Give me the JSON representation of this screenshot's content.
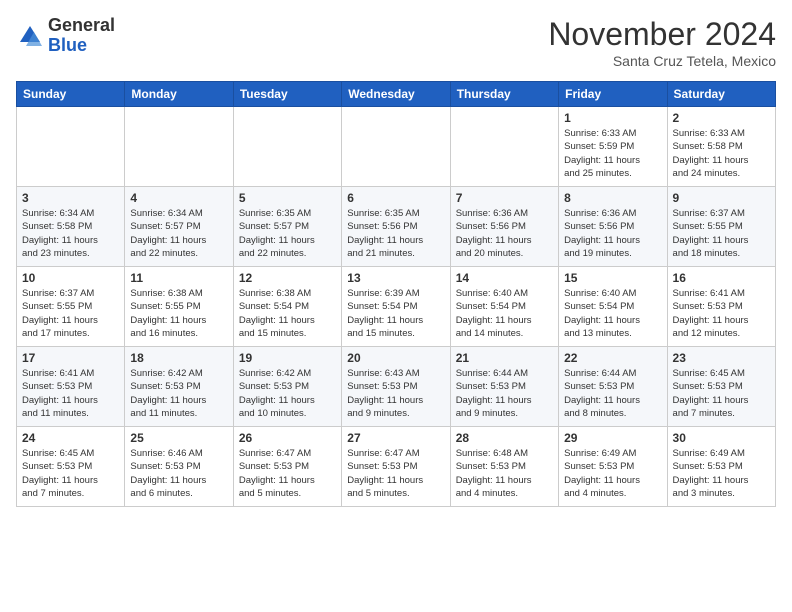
{
  "header": {
    "logo_line1": "General",
    "logo_line2": "Blue",
    "month": "November 2024",
    "location": "Santa Cruz Tetela, Mexico"
  },
  "weekdays": [
    "Sunday",
    "Monday",
    "Tuesday",
    "Wednesday",
    "Thursday",
    "Friday",
    "Saturday"
  ],
  "weeks": [
    [
      {
        "day": "",
        "info": ""
      },
      {
        "day": "",
        "info": ""
      },
      {
        "day": "",
        "info": ""
      },
      {
        "day": "",
        "info": ""
      },
      {
        "day": "",
        "info": ""
      },
      {
        "day": "1",
        "info": "Sunrise: 6:33 AM\nSunset: 5:59 PM\nDaylight: 11 hours\nand 25 minutes."
      },
      {
        "day": "2",
        "info": "Sunrise: 6:33 AM\nSunset: 5:58 PM\nDaylight: 11 hours\nand 24 minutes."
      }
    ],
    [
      {
        "day": "3",
        "info": "Sunrise: 6:34 AM\nSunset: 5:58 PM\nDaylight: 11 hours\nand 23 minutes."
      },
      {
        "day": "4",
        "info": "Sunrise: 6:34 AM\nSunset: 5:57 PM\nDaylight: 11 hours\nand 22 minutes."
      },
      {
        "day": "5",
        "info": "Sunrise: 6:35 AM\nSunset: 5:57 PM\nDaylight: 11 hours\nand 22 minutes."
      },
      {
        "day": "6",
        "info": "Sunrise: 6:35 AM\nSunset: 5:56 PM\nDaylight: 11 hours\nand 21 minutes."
      },
      {
        "day": "7",
        "info": "Sunrise: 6:36 AM\nSunset: 5:56 PM\nDaylight: 11 hours\nand 20 minutes."
      },
      {
        "day": "8",
        "info": "Sunrise: 6:36 AM\nSunset: 5:56 PM\nDaylight: 11 hours\nand 19 minutes."
      },
      {
        "day": "9",
        "info": "Sunrise: 6:37 AM\nSunset: 5:55 PM\nDaylight: 11 hours\nand 18 minutes."
      }
    ],
    [
      {
        "day": "10",
        "info": "Sunrise: 6:37 AM\nSunset: 5:55 PM\nDaylight: 11 hours\nand 17 minutes."
      },
      {
        "day": "11",
        "info": "Sunrise: 6:38 AM\nSunset: 5:55 PM\nDaylight: 11 hours\nand 16 minutes."
      },
      {
        "day": "12",
        "info": "Sunrise: 6:38 AM\nSunset: 5:54 PM\nDaylight: 11 hours\nand 15 minutes."
      },
      {
        "day": "13",
        "info": "Sunrise: 6:39 AM\nSunset: 5:54 PM\nDaylight: 11 hours\nand 15 minutes."
      },
      {
        "day": "14",
        "info": "Sunrise: 6:40 AM\nSunset: 5:54 PM\nDaylight: 11 hours\nand 14 minutes."
      },
      {
        "day": "15",
        "info": "Sunrise: 6:40 AM\nSunset: 5:54 PM\nDaylight: 11 hours\nand 13 minutes."
      },
      {
        "day": "16",
        "info": "Sunrise: 6:41 AM\nSunset: 5:53 PM\nDaylight: 11 hours\nand 12 minutes."
      }
    ],
    [
      {
        "day": "17",
        "info": "Sunrise: 6:41 AM\nSunset: 5:53 PM\nDaylight: 11 hours\nand 11 minutes."
      },
      {
        "day": "18",
        "info": "Sunrise: 6:42 AM\nSunset: 5:53 PM\nDaylight: 11 hours\nand 11 minutes."
      },
      {
        "day": "19",
        "info": "Sunrise: 6:42 AM\nSunset: 5:53 PM\nDaylight: 11 hours\nand 10 minutes."
      },
      {
        "day": "20",
        "info": "Sunrise: 6:43 AM\nSunset: 5:53 PM\nDaylight: 11 hours\nand 9 minutes."
      },
      {
        "day": "21",
        "info": "Sunrise: 6:44 AM\nSunset: 5:53 PM\nDaylight: 11 hours\nand 9 minutes."
      },
      {
        "day": "22",
        "info": "Sunrise: 6:44 AM\nSunset: 5:53 PM\nDaylight: 11 hours\nand 8 minutes."
      },
      {
        "day": "23",
        "info": "Sunrise: 6:45 AM\nSunset: 5:53 PM\nDaylight: 11 hours\nand 7 minutes."
      }
    ],
    [
      {
        "day": "24",
        "info": "Sunrise: 6:45 AM\nSunset: 5:53 PM\nDaylight: 11 hours\nand 7 minutes."
      },
      {
        "day": "25",
        "info": "Sunrise: 6:46 AM\nSunset: 5:53 PM\nDaylight: 11 hours\nand 6 minutes."
      },
      {
        "day": "26",
        "info": "Sunrise: 6:47 AM\nSunset: 5:53 PM\nDaylight: 11 hours\nand 5 minutes."
      },
      {
        "day": "27",
        "info": "Sunrise: 6:47 AM\nSunset: 5:53 PM\nDaylight: 11 hours\nand 5 minutes."
      },
      {
        "day": "28",
        "info": "Sunrise: 6:48 AM\nSunset: 5:53 PM\nDaylight: 11 hours\nand 4 minutes."
      },
      {
        "day": "29",
        "info": "Sunrise: 6:49 AM\nSunset: 5:53 PM\nDaylight: 11 hours\nand 4 minutes."
      },
      {
        "day": "30",
        "info": "Sunrise: 6:49 AM\nSunset: 5:53 PM\nDaylight: 11 hours\nand 3 minutes."
      }
    ]
  ]
}
